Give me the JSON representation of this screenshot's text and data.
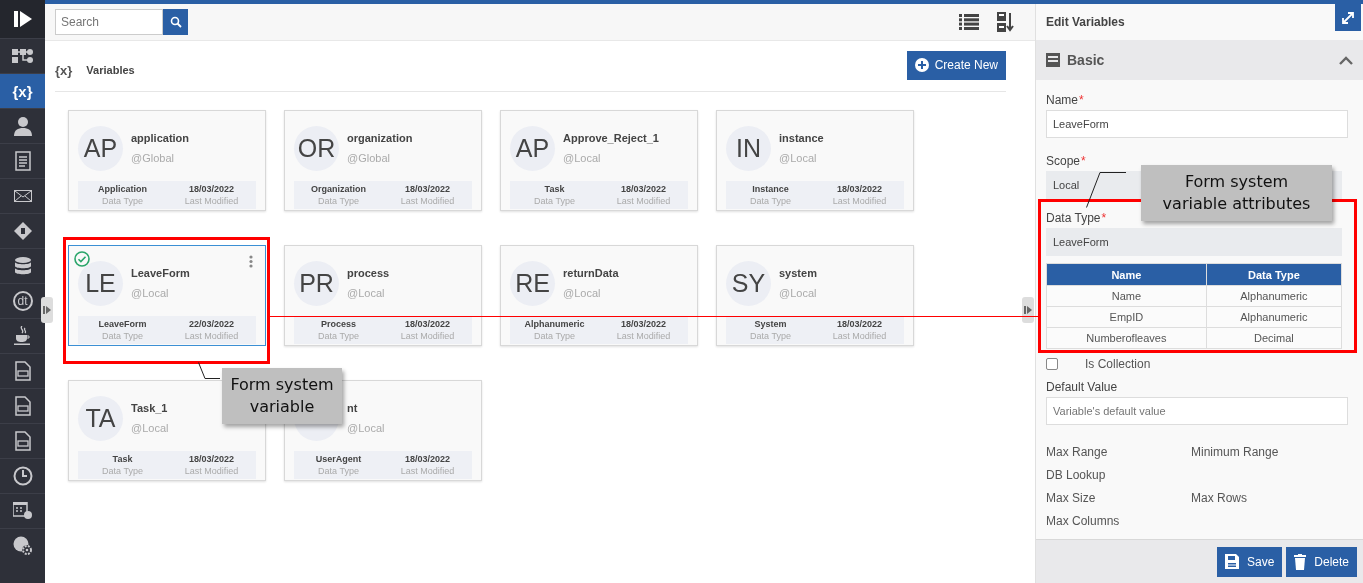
{
  "sidebar": {
    "items": [
      {
        "kind": "logo",
        "selected": false
      },
      {
        "kind": "flow",
        "selected": false
      },
      {
        "kind": "variables",
        "label": "{x}",
        "selected": true
      },
      {
        "kind": "user",
        "selected": false
      },
      {
        "kind": "document",
        "selected": false
      },
      {
        "kind": "mail",
        "selected": false
      },
      {
        "kind": "diamond",
        "selected": false
      },
      {
        "kind": "database",
        "selected": false
      },
      {
        "kind": "circle-label",
        "label": "dt",
        "selected": false
      },
      {
        "kind": "cup",
        "selected": false
      },
      {
        "kind": "file",
        "selected": false
      },
      {
        "kind": "file",
        "selected": false
      },
      {
        "kind": "file",
        "selected": false
      },
      {
        "kind": "clock",
        "selected": false
      },
      {
        "kind": "calendar",
        "selected": false
      },
      {
        "kind": "globe",
        "selected": false
      }
    ]
  },
  "toolbar": {
    "search": {
      "placeholder": "Search"
    }
  },
  "header": {
    "icon_label": "{x}",
    "title": "Variables",
    "create_button": "Create New"
  },
  "cards": [
    {
      "initials": "AP",
      "name": "application",
      "scope": "@Global",
      "data_type": "Application",
      "data_type_label": "Data Type",
      "modified": "18/03/2022",
      "modified_label": "Last Modified",
      "selected": false
    },
    {
      "initials": "OR",
      "name": "organization",
      "scope": "@Global",
      "data_type": "Organization",
      "data_type_label": "Data Type",
      "modified": "18/03/2022",
      "modified_label": "Last Modified",
      "selected": false
    },
    {
      "initials": "AP",
      "name": "Approve_Reject_1",
      "scope": "@Local",
      "data_type": "Task",
      "data_type_label": "Data Type",
      "modified": "18/03/2022",
      "modified_label": "Last Modified",
      "selected": false
    },
    {
      "initials": "IN",
      "name": "instance",
      "scope": "@Local",
      "data_type": "Instance",
      "data_type_label": "Data Type",
      "modified": "18/03/2022",
      "modified_label": "Last Modified",
      "selected": false
    },
    {
      "initials": "LE",
      "name": "LeaveForm",
      "scope": "@Local",
      "data_type": "LeaveForm",
      "data_type_label": "Data Type",
      "modified": "22/03/2022",
      "modified_label": "Last Modified",
      "selected": true
    },
    {
      "initials": "PR",
      "name": "process",
      "scope": "@Local",
      "data_type": "Process",
      "data_type_label": "Data Type",
      "modified": "18/03/2022",
      "modified_label": "Last Modified",
      "selected": false
    },
    {
      "initials": "RE",
      "name": "returnData",
      "scope": "@Local",
      "data_type": "Alphanumeric",
      "data_type_label": "Data Type",
      "modified": "18/03/2022",
      "modified_label": "Last Modified",
      "selected": false
    },
    {
      "initials": "SY",
      "name": "system",
      "scope": "@Local",
      "data_type": "System",
      "data_type_label": "Data Type",
      "modified": "18/03/2022",
      "modified_label": "Last Modified",
      "selected": false
    },
    {
      "initials": "TA",
      "name": "Task_1",
      "scope": "@Local",
      "data_type": "Task",
      "data_type_label": "Data Type",
      "modified": "18/03/2022",
      "modified_label": "Last Modified",
      "selected": false
    },
    {
      "name": "nt",
      "scope": "@Local",
      "data_type": "UserAgent",
      "data_type_label": "Data Type",
      "modified": "18/03/2022",
      "modified_label": "Last Modified",
      "selected": false
    }
  ],
  "panel": {
    "title": "Edit Variables",
    "section": {
      "title": "Basic",
      "expanded": true
    },
    "required_mark": "*",
    "fields": [
      {
        "kind": "input",
        "label": "Name",
        "required": true,
        "value": "LeaveForm",
        "readonly": false
      },
      {
        "kind": "input",
        "label": "Scope",
        "required": true,
        "value": "Local",
        "readonly": true
      },
      {
        "kind": "input",
        "label": "Data Type",
        "required": true,
        "value": "LeaveForm",
        "readonly": true
      },
      {
        "kind": "table",
        "columns": [
          "Name",
          "Data Type"
        ],
        "rows": [
          [
            "Name",
            "Alphanumeric"
          ],
          [
            "EmpID",
            "Alphanumeric"
          ],
          [
            "Numberofleaves",
            "Decimal"
          ]
        ]
      },
      {
        "kind": "checkbox",
        "label": "Is Collection",
        "checked": false
      },
      {
        "kind": "input",
        "label": "Default Value",
        "required": false,
        "placeholder": "Variable's default value",
        "readonly": false
      },
      {
        "kind": "pair",
        "labels": [
          "Max Range",
          "Minimum Range"
        ]
      },
      {
        "kind": "pair",
        "labels": [
          "DB Lookup"
        ]
      },
      {
        "kind": "pair",
        "labels": [
          "Max Size",
          "Max Rows"
        ]
      },
      {
        "kind": "pair",
        "labels": [
          "Max Columns"
        ]
      }
    ],
    "buttons": [
      {
        "kind": "save",
        "label": "Save"
      },
      {
        "kind": "delete",
        "label": "Delete"
      }
    ]
  },
  "annotations": [
    {
      "kind": "card",
      "lines": [
        "Form system",
        "variable"
      ]
    },
    {
      "kind": "panel",
      "lines": [
        "Form system",
        "variable attributes"
      ]
    }
  ]
}
